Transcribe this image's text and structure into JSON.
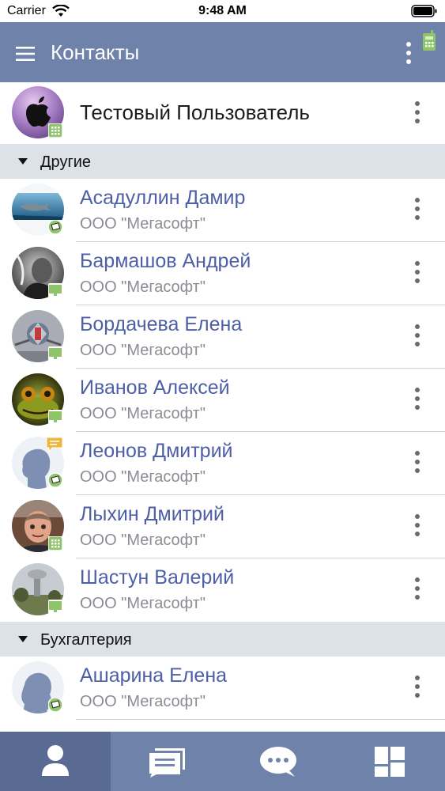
{
  "status_bar": {
    "carrier": "Carrier",
    "time": "9:48 AM"
  },
  "app_bar": {
    "title": "Контакты",
    "menu_icon": "hamburger-menu-icon",
    "more_icon": "more-vertical-icon",
    "phone_icon": "softphone-icon"
  },
  "current_user": {
    "name": "Тестовый Пользователь",
    "avatar": "apple-logo-avatar",
    "presence": "softphone"
  },
  "sections": [
    {
      "label": "Другие",
      "contacts": [
        {
          "name": "Асадуллин Дамир",
          "org": "ООО \"Мегасофт\"",
          "presence": "mobile"
        },
        {
          "name": "Бармашов Андрей",
          "org": "ООО \"Мегасофт\"",
          "presence": "desktop"
        },
        {
          "name": "Бордачева Елена",
          "org": "ООО \"Мегасофт\"",
          "presence": "desktop"
        },
        {
          "name": "Иванов Алексей",
          "org": "ООО \"Мегасофт\"",
          "presence": "desktop"
        },
        {
          "name": "Леонов Дмитрий",
          "org": "ООО \"Мегасофт\"",
          "presence": "mobile",
          "badge": "message"
        },
        {
          "name": "Лыхин Дмитрий",
          "org": "ООО \"Мегасофт\"",
          "presence": "softphone"
        },
        {
          "name": "Шастун Валерий",
          "org": "ООО \"Мегасофт\"",
          "presence": "desktop"
        }
      ]
    },
    {
      "label": "Бухгалтерия",
      "contacts": [
        {
          "name": "Ашарина Елена",
          "org": "ООО \"Мегасофт\"",
          "presence": "mobile"
        }
      ]
    }
  ],
  "tabs": [
    {
      "name": "contacts",
      "icon": "person-icon",
      "active": true
    },
    {
      "name": "messages",
      "icon": "messages-icon",
      "active": false
    },
    {
      "name": "chat",
      "icon": "chat-bubble-icon",
      "active": false
    },
    {
      "name": "apps",
      "icon": "tiles-icon",
      "active": false
    }
  ],
  "colors": {
    "header": "#6f83aa",
    "tab_active": "#596b93",
    "name": "#4e5fa6",
    "org": "#8a8d93",
    "section_bg": "#dde1e8",
    "presence_green": "#8fc46a"
  }
}
